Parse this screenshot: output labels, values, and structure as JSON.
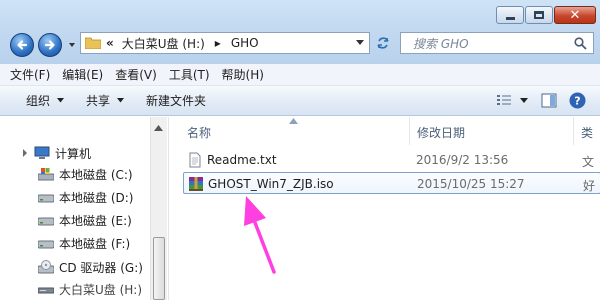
{
  "window": {
    "address": {
      "chevron": "«",
      "segments": [
        "大白菜U盘 (H:)",
        "GHO"
      ]
    },
    "search_placeholder": "搜索 GHO"
  },
  "menu": [
    "文件(F)",
    "编辑(E)",
    "查看(V)",
    "工具(T)",
    "帮助(H)"
  ],
  "toolbar": {
    "organize": "组织",
    "share": "共享",
    "new_folder": "新建文件夹"
  },
  "tree": [
    {
      "label": "计算机",
      "icon": "computer-icon",
      "level": 0
    },
    {
      "label": "本地磁盘 (C:)",
      "icon": "system-drive-icon",
      "level": 1
    },
    {
      "label": "本地磁盘 (D:)",
      "icon": "hard-drive-icon",
      "level": 1
    },
    {
      "label": "本地磁盘 (E:)",
      "icon": "hard-drive-icon",
      "level": 1
    },
    {
      "label": "本地磁盘 (F:)",
      "icon": "hard-drive-icon",
      "level": 1
    },
    {
      "label": "CD 驱动器 (G:)",
      "icon": "cd-drive-icon",
      "level": 1
    },
    {
      "label": "大白菜U盘 (H:)",
      "icon": "usb-drive-icon",
      "level": 1,
      "selected": true
    }
  ],
  "columns": {
    "name": "名称",
    "modified": "修改日期",
    "type": "类"
  },
  "files": [
    {
      "name": "Readme.txt",
      "modified": "2016/9/2 13:56",
      "type": "文",
      "icon": "text-file-icon"
    },
    {
      "name": "GHOST_Win7_ZJB.iso",
      "modified": "2015/10/25 15:27",
      "type": "好",
      "icon": "winrar-archive-icon",
      "selected": true
    }
  ],
  "annotation": {
    "color": "#ff3fe0",
    "target": "GHOST_Win7_ZJB.iso"
  },
  "colors": {
    "accent": "#2c6fc4",
    "selection": "#c4ddf8"
  }
}
